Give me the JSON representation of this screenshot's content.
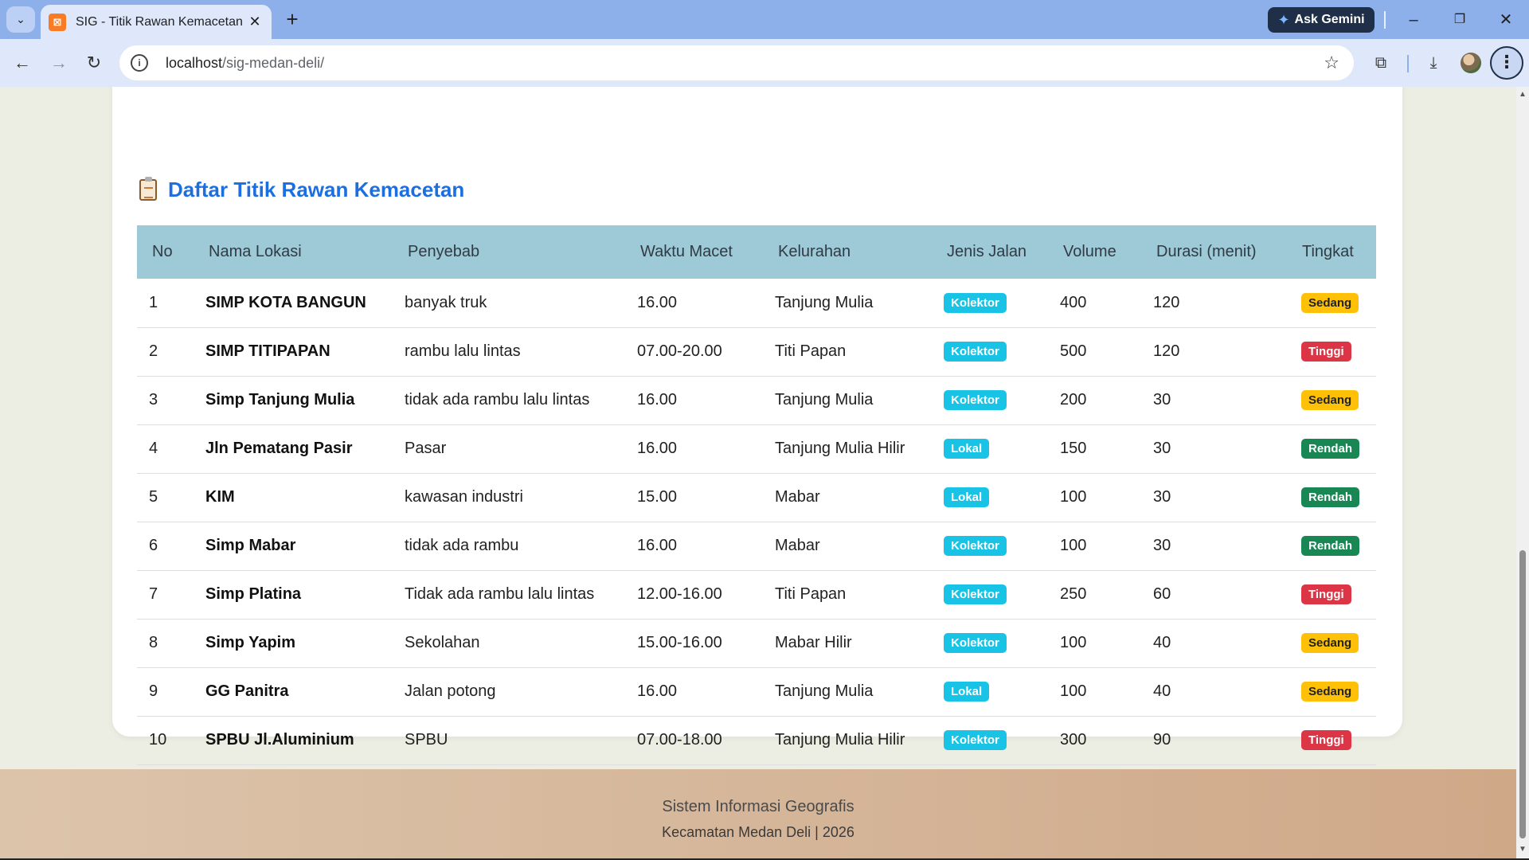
{
  "browser": {
    "tab_title": "SIG - Titik Rawan Kemacetan Ke",
    "favicon_letter": "⊠",
    "ask_gemini": "Ask Gemini",
    "url_host": "localhost",
    "url_path": "/sig-medan-deli/"
  },
  "section": {
    "title": "Daftar Titik Rawan Kemacetan"
  },
  "table": {
    "headers": [
      "No",
      "Nama Lokasi",
      "Penyebab",
      "Waktu Macet",
      "Kelurahan",
      "Jenis Jalan",
      "Volume",
      "Durasi (menit)",
      "Tingkat"
    ],
    "rows": [
      {
        "no": "1",
        "nama": "SIMP KOTA BANGUN",
        "penyebab": "banyak truk",
        "waktu": "16.00",
        "kelurahan": "Tanjung Mulia",
        "jenis": "Kolektor",
        "volume": "400",
        "durasi": "120",
        "tingkat": "Sedang"
      },
      {
        "no": "2",
        "nama": "SIMP TITIPAPAN",
        "penyebab": "rambu lalu lintas",
        "waktu": "07.00-20.00",
        "kelurahan": "Titi Papan",
        "jenis": "Kolektor",
        "volume": "500",
        "durasi": "120",
        "tingkat": "Tinggi"
      },
      {
        "no": "3",
        "nama": "Simp Tanjung Mulia",
        "penyebab": "tidak ada rambu lalu lintas",
        "waktu": "16.00",
        "kelurahan": "Tanjung Mulia",
        "jenis": "Kolektor",
        "volume": "200",
        "durasi": "30",
        "tingkat": "Sedang"
      },
      {
        "no": "4",
        "nama": "Jln Pematang Pasir",
        "penyebab": "Pasar",
        "waktu": "16.00",
        "kelurahan": "Tanjung Mulia Hilir",
        "jenis": "Lokal",
        "volume": "150",
        "durasi": "30",
        "tingkat": "Rendah"
      },
      {
        "no": "5",
        "nama": "KIM",
        "penyebab": "kawasan industri",
        "waktu": "15.00",
        "kelurahan": "Mabar",
        "jenis": "Lokal",
        "volume": "100",
        "durasi": "30",
        "tingkat": "Rendah"
      },
      {
        "no": "6",
        "nama": "Simp Mabar",
        "penyebab": "tidak ada rambu",
        "waktu": "16.00",
        "kelurahan": "Mabar",
        "jenis": "Kolektor",
        "volume": "100",
        "durasi": "30",
        "tingkat": "Rendah"
      },
      {
        "no": "7",
        "nama": "Simp Platina",
        "penyebab": "Tidak ada rambu lalu lintas",
        "waktu": "12.00-16.00",
        "kelurahan": "Titi Papan",
        "jenis": "Kolektor",
        "volume": "250",
        "durasi": "60",
        "tingkat": "Tinggi"
      },
      {
        "no": "8",
        "nama": "Simp Yapim",
        "penyebab": "Sekolahan",
        "waktu": "15.00-16.00",
        "kelurahan": "Mabar Hilir",
        "jenis": "Kolektor",
        "volume": "100",
        "durasi": "40",
        "tingkat": "Sedang"
      },
      {
        "no": "9",
        "nama": "GG Panitra",
        "penyebab": "Jalan potong",
        "waktu": "16.00",
        "kelurahan": "Tanjung Mulia",
        "jenis": "Lokal",
        "volume": "100",
        "durasi": "40",
        "tingkat": "Sedang"
      },
      {
        "no": "10",
        "nama": "SPBU Jl.Aluminium",
        "penyebab": "SPBU",
        "waktu": "07.00-18.00",
        "kelurahan": "Tanjung Mulia Hilir",
        "jenis": "Kolektor",
        "volume": "300",
        "durasi": "90",
        "tingkat": "Tinggi"
      }
    ]
  },
  "footer": {
    "line1": "Sistem Informasi Geografis",
    "line2": "Kecamatan Medan Deli | 2026"
  },
  "colors": {
    "tab_strip": "#8db0eb",
    "table_header": "#9ec9d6",
    "section_title": "#1c6fe0",
    "badge_sedang": "#ffc107",
    "badge_tinggi": "#dc3545",
    "badge_rendah": "#198754",
    "badge_jalan": "#19c3e6"
  }
}
